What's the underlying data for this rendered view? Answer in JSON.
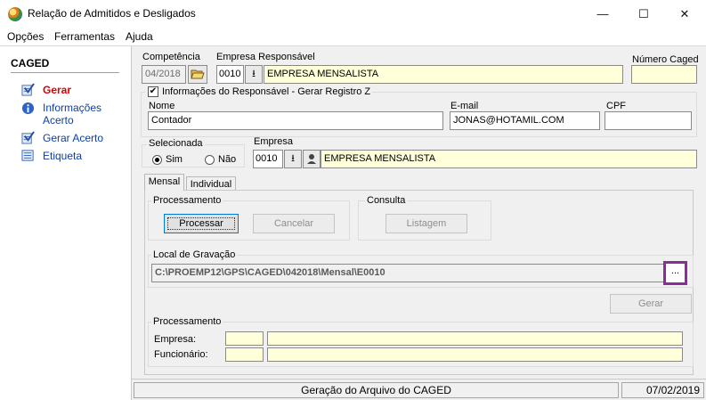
{
  "window": {
    "title": "Relação de Admitidos e Desligados"
  },
  "menu": {
    "opcoes": "Opções",
    "ferramentas": "Ferramentas",
    "ajuda": "Ajuda"
  },
  "sidebar": {
    "title": "CAGED",
    "items": [
      {
        "label": "Gerar",
        "icon": "checklist-icon"
      },
      {
        "label": "Informações Acerto",
        "icon": "info-icon"
      },
      {
        "label": "Gerar Acerto",
        "icon": "checklist-icon"
      },
      {
        "label": "Etiqueta",
        "icon": "label-icon"
      }
    ]
  },
  "header": {
    "competencia_label": "Competência",
    "competencia_value": "04/2018",
    "empresa_resp_label": "Empresa Responsável",
    "empresa_resp_code": "0010",
    "empresa_resp_name": "EMPRESA MENSALISTA",
    "numero_caged_label": "Número Caged",
    "numero_caged_value": ""
  },
  "responsavel": {
    "checkbox_label": "Informações do Responsável - Gerar Registro Z",
    "checked": true,
    "nome_label": "Nome",
    "nome_value": "Contador",
    "email_label": "E-mail",
    "email_value": "JONAS@HOTAMIL.COM",
    "cpf_label": "CPF",
    "cpf_value": ""
  },
  "selecionada": {
    "label": "Selecionada",
    "sim": "Sim",
    "nao": "Não",
    "selected": "Sim"
  },
  "empresa": {
    "label": "Empresa",
    "code": "0010",
    "name": "EMPRESA MENSALISTA"
  },
  "tabs": {
    "mensal": "Mensal",
    "individual": "Individual",
    "active": "Mensal"
  },
  "processamento": {
    "title": "Processamento",
    "processar": "Processar",
    "cancelar": "Cancelar"
  },
  "consulta": {
    "title": "Consulta",
    "listagem": "Listagem"
  },
  "local": {
    "title": "Local de Gravação",
    "path": "C:\\PROEMP12\\GPS\\CAGED\\042018\\Mensal\\E0010",
    "browse": "..."
  },
  "gerar_button": "Gerar",
  "processamento2": {
    "title": "Processamento",
    "empresa_label": "Empresa:",
    "funcionario_label": "Funcionário:"
  },
  "status": {
    "message": "Geração do Arquivo do CAGED",
    "date": "07/02/2019"
  },
  "colors": {
    "highlight_border": "#8f2a9e",
    "field_yellow": "#ffffd9",
    "link_blue": "#0b3ea8",
    "active_red": "#e00000"
  }
}
